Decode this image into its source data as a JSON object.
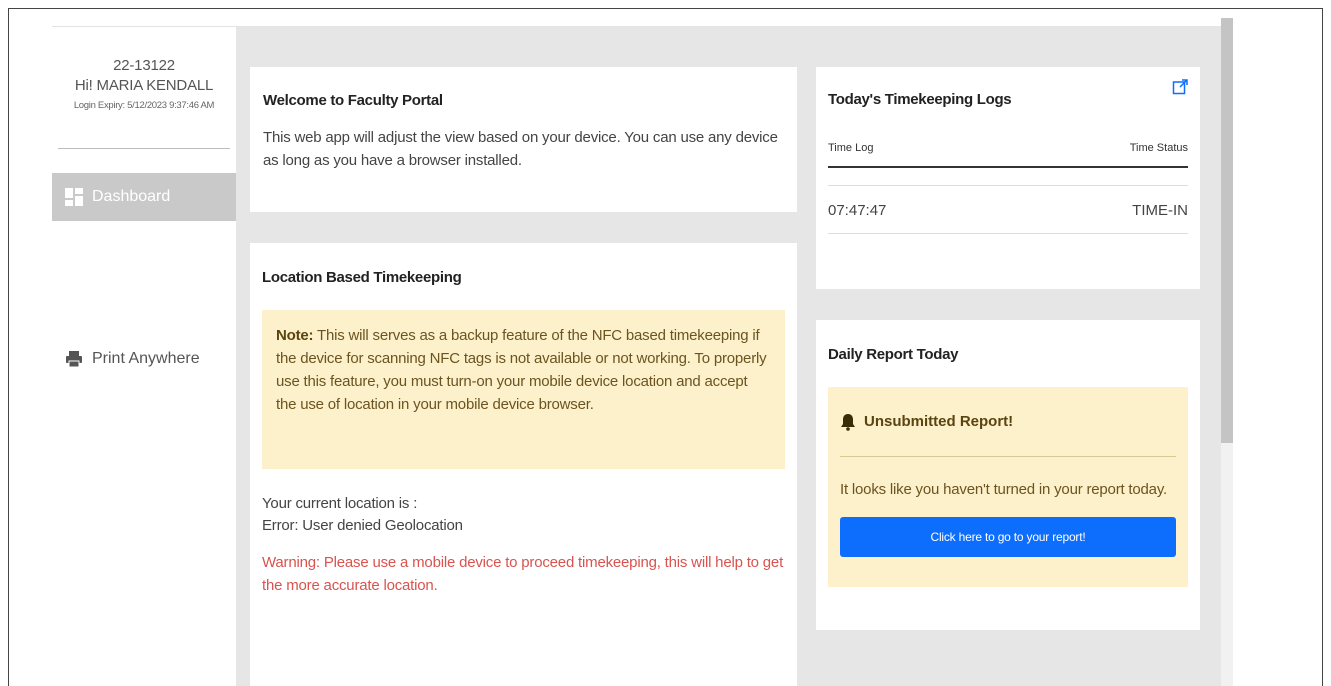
{
  "profile": {
    "id": "22-13122",
    "greeting": "Hi! MARIA KENDALL",
    "login_expiry": "Login Expiry: 5/12/2023 9:37:46 AM"
  },
  "sidebar": {
    "items": [
      {
        "label": "Dashboard",
        "icon": "dashboard-icon",
        "active": true
      },
      {
        "label": "Print Anywhere",
        "icon": "printer-icon",
        "active": false
      }
    ]
  },
  "welcome": {
    "title": "Welcome to Faculty Portal",
    "text": "This web app will adjust the view based on your device. You can use any device as long as you have a browser installed."
  },
  "location": {
    "title": "Location Based Timekeeping",
    "note_label": "Note:",
    "note_text": " This will serves as a backup feature of the NFC based timekeeping if the device for scanning NFC tags is not available or not working. To properly use this feature, you must turn-on your mobile device location and accept the use of location in your mobile device browser.",
    "current_label": "Your current location is :",
    "current_value": "Error: User denied Geolocation",
    "warning": "Warning: Please use a mobile device to proceed timekeeping, this will help to get the more accurate location."
  },
  "logs": {
    "title": "Today's Timekeeping Logs",
    "columns": [
      "Time Log",
      "Time Status"
    ],
    "rows": [
      {
        "time": "07:47:47",
        "status": "TIME-IN"
      }
    ]
  },
  "report": {
    "title": "Daily Report Today",
    "alert_title": "Unsubmitted Report!",
    "alert_text": "It looks like you haven't turned in your report today.",
    "button_label": "Click here to go to your report!"
  },
  "colors": {
    "main_bg": "#e6e6e6",
    "note_bg": "#fdf1cc",
    "warning_text": "#d9534f",
    "button_bg": "#0d6efd",
    "active_nav_bg": "#c9c9c9"
  }
}
